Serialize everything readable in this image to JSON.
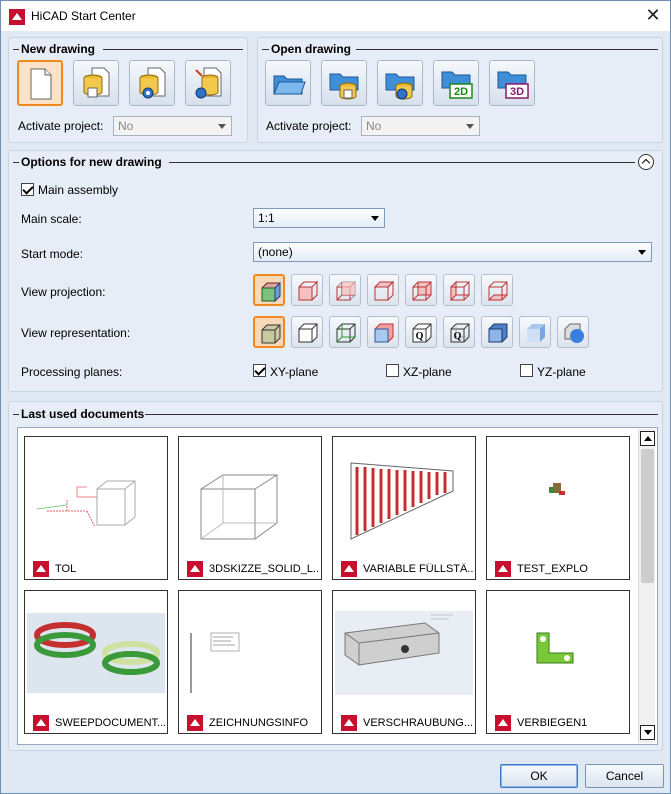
{
  "window": {
    "title": "HiCAD Start Center",
    "close": "✕"
  },
  "new_drawing": {
    "title": "New drawing",
    "activate_label": "Activate project:",
    "activate_value": "No"
  },
  "open_drawing": {
    "title": "Open drawing",
    "activate_label": "Activate project:",
    "activate_value": "No",
    "btn_2d": "2D",
    "btn_3d": "3D"
  },
  "options": {
    "title": "Options for new drawing",
    "main_assembly": "Main assembly",
    "main_scale_label": "Main scale:",
    "main_scale_value": "1:1",
    "start_mode_label": "Start mode:",
    "start_mode_value": "(none)",
    "view_projection_label": "View projection:",
    "view_representation_label": "View representation:",
    "processing_planes_label": "Processing planes:",
    "planes": [
      {
        "label": "XY-plane",
        "checked": true
      },
      {
        "label": "XZ-plane",
        "checked": false
      },
      {
        "label": "YZ-plane",
        "checked": false
      }
    ],
    "rep_q1": "Q",
    "rep_q2": "Q"
  },
  "last_used": {
    "title": "Last used documents",
    "docs": [
      {
        "name": "TOL"
      },
      {
        "name": "3DSKIZZE_SOLID_L..."
      },
      {
        "name": "VARIABLE FÜLLSTÄ..."
      },
      {
        "name": "TEST_EXPLO"
      },
      {
        "name": "SWEEPDOCUMENT..."
      },
      {
        "name": "ZEICHNUNGSINFO"
      },
      {
        "name": "VERSCHRAUBUNG..."
      },
      {
        "name": "VERBIEGEN1"
      }
    ]
  },
  "footer": {
    "ok": "OK",
    "cancel": "Cancel"
  },
  "colors": {
    "accent": "#f08a1f",
    "panel": "#e6edf6",
    "brand_red": "#c8102e"
  }
}
